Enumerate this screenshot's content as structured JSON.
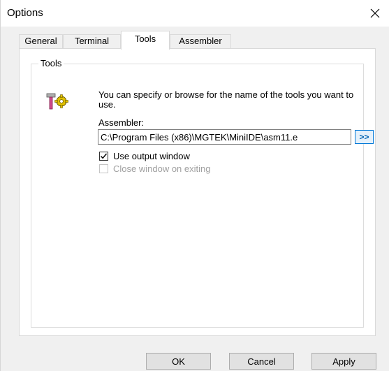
{
  "window": {
    "title": "Options",
    "close_icon": "close-icon"
  },
  "tabs": [
    {
      "label": "General",
      "active": false
    },
    {
      "label": "Terminal",
      "active": false
    },
    {
      "label": "Tools",
      "active": true
    },
    {
      "label": "Assembler",
      "active": false
    }
  ],
  "tools_group": {
    "legend": "Tools",
    "icon": "tools-icon",
    "description": "You can specify or browse for the name of the tools you want to use.",
    "assembler_label": "Assembler:",
    "assembler_path": "C:\\Program Files (x86)\\MGTEK\\MiniIDE\\asm11.e",
    "browse_label": ">>",
    "use_output_window": {
      "label": "Use output window",
      "checked": true,
      "enabled": true
    },
    "close_window_on_exiting": {
      "label": "Close window on exiting",
      "checked": false,
      "enabled": false
    }
  },
  "buttons": {
    "ok": "OK",
    "cancel": "Cancel",
    "apply": "Apply"
  }
}
